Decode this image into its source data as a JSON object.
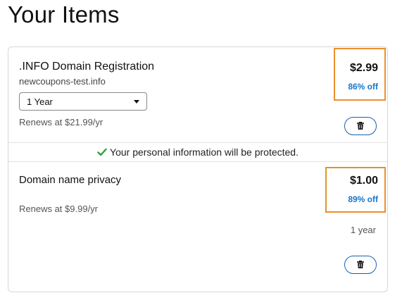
{
  "page": {
    "title": "Your Items"
  },
  "items": [
    {
      "name": ".INFO Domain Registration",
      "domain": "newcoupons-test.info",
      "term_select": {
        "selected": "1 Year"
      },
      "renewal": "Renews at $21.99/yr",
      "price": "$2.99",
      "discount": "86% off"
    },
    {
      "name": "Domain name privacy",
      "renewal": "Renews at $9.99/yr",
      "price": "$1.00",
      "discount": "89% off",
      "term": "1 year"
    }
  ],
  "privacy_notice": {
    "text": "Your personal information will be protected."
  },
  "colors": {
    "highlight_border": "#e8912a",
    "discount_text": "#1976c9",
    "check": "#2e9e3f",
    "button_border": "#1a5fb0"
  },
  "icons": {
    "delete": "trash-icon",
    "notice": "checkmark-icon",
    "select": "caret-down-icon"
  }
}
